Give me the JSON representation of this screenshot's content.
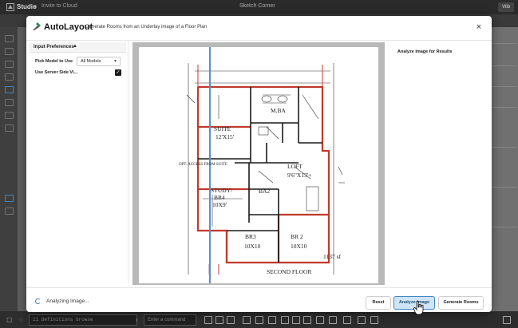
{
  "app": {
    "name": "Studio",
    "invite_label": "Invite to Cloud",
    "file_title": "Sketch Corner",
    "user_badge": "Vlib"
  },
  "bottombar": {
    "console_placeholder": "11 definitions  browse",
    "command_placeholder": "Enter a command"
  },
  "modal": {
    "title": "AutoLayout",
    "subtitle": "Generate Rooms from an Underlay image of a Floor Plan",
    "close_label": "×",
    "preferences": {
      "section_title": "Input Preferences",
      "model_label": "Pick Model to Use",
      "model_value": "All Models",
      "server_label": "Use Server Side Vi...",
      "server_checked": true
    },
    "results_title": "Analyze Image for Results",
    "floorplan": {
      "labels": [
        "M.BA",
        "SUITE",
        "12'X15'",
        "LOFT",
        "9'6\"X13'+",
        "OPT. ACCESS FROM SUITE",
        "STUDY/",
        "BR4",
        "10X9'",
        "BA2",
        "BR3",
        "10X10",
        "BR 2",
        "10X10",
        "1137 sf",
        "SECOND FLOOR"
      ]
    },
    "footer": {
      "status": "Analyzing Image...",
      "reset_label": "Reset",
      "analyze_label": "Analyze Image",
      "generate_label": "Generate Rooms"
    }
  },
  "colors": {
    "accent": "#3f86c4",
    "modal_bg": "#ffffff",
    "overlay": "#6b6b6b",
    "plan_red": "#c0392b"
  }
}
